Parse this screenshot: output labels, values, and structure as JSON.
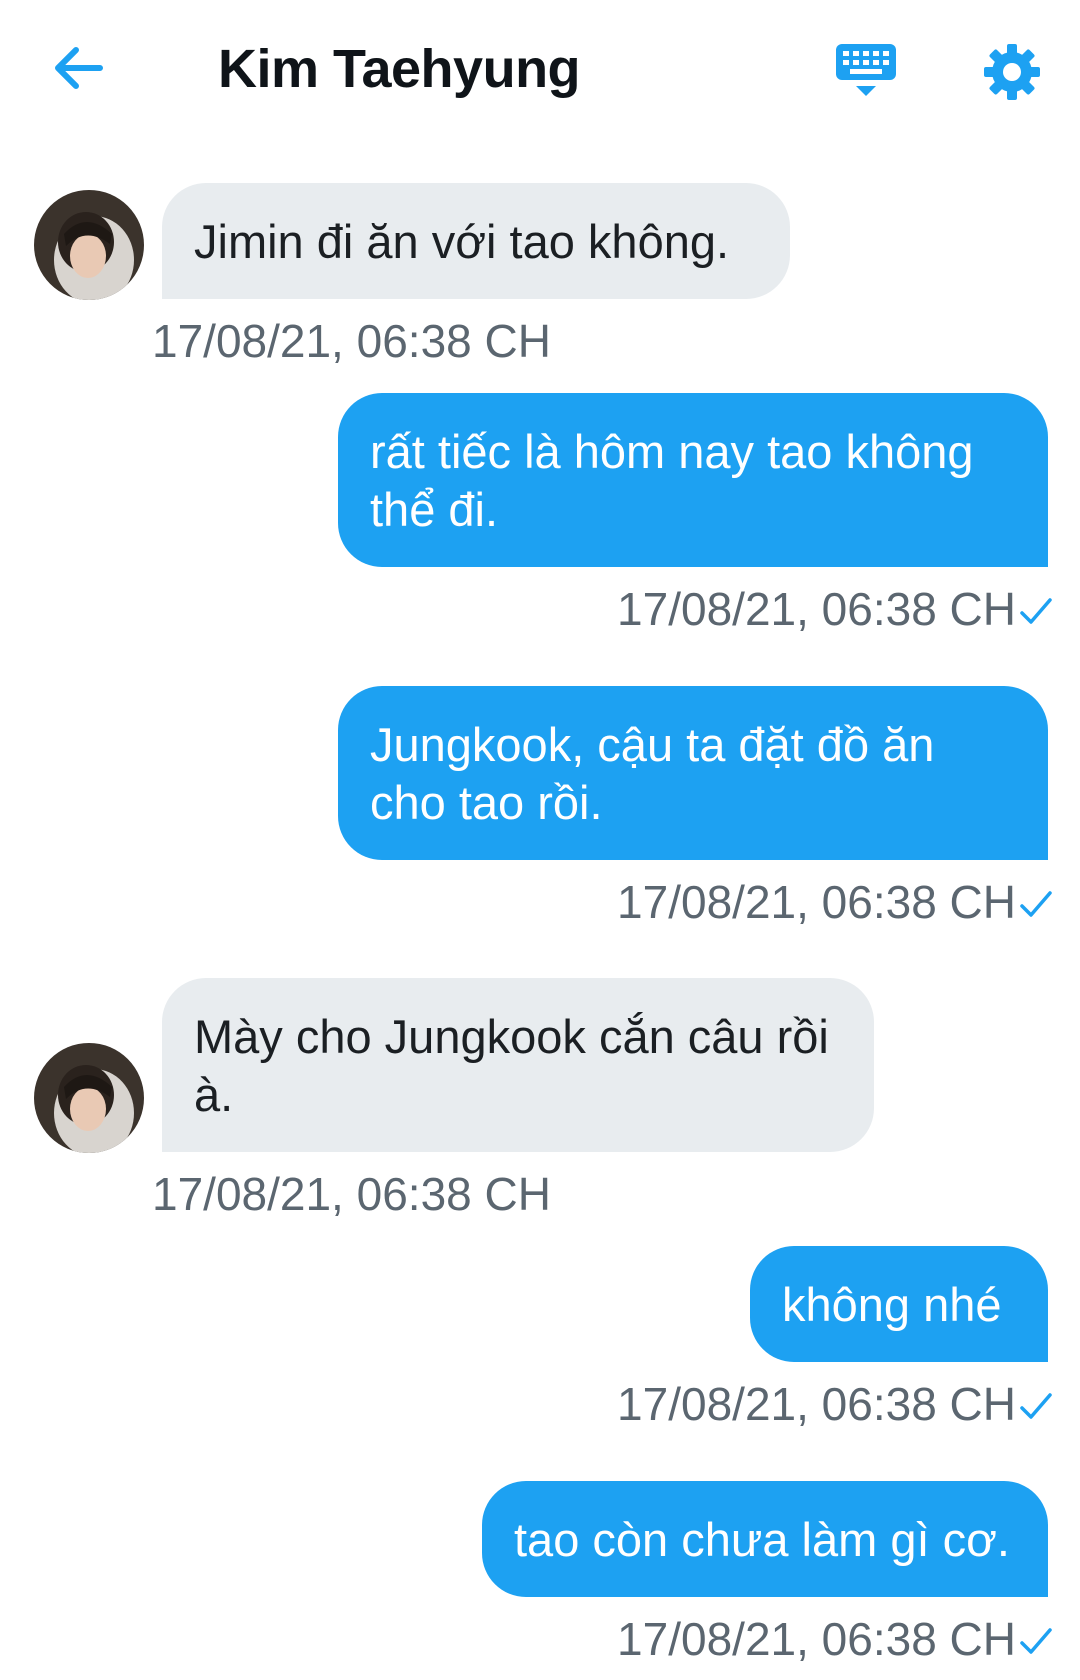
{
  "header": {
    "back_icon": "arrow-left-icon",
    "title": "Kim Taehyung",
    "keyboard_icon": "keyboard-icon",
    "settings_icon": "gear-icon"
  },
  "colors": {
    "accent": "#1da1f2",
    "incoming_bubble": "#e8ecef",
    "timestamp": "#5b6670"
  },
  "messages": [
    {
      "direction": "in",
      "text": "Jimin đi ăn với tao không.",
      "time": "17/08/21, 06:38 CH"
    },
    {
      "direction": "out",
      "text": "rất tiếc là hôm nay tao không thể đi.",
      "time": "17/08/21, 06:38 CH",
      "status_icon": "check-icon"
    },
    {
      "direction": "out",
      "text": "Jungkook, cậu ta đặt đồ ăn cho tao rồi.",
      "time": "17/08/21, 06:38 CH",
      "status_icon": "check-icon"
    },
    {
      "direction": "in",
      "text": "Mày cho Jungkook cắn câu rồi à.",
      "time": "17/08/21, 06:38 CH"
    },
    {
      "direction": "out",
      "text": "không nhé",
      "time": "17/08/21, 06:38 CH",
      "status_icon": "check-icon"
    },
    {
      "direction": "out",
      "text": "tao còn chưa làm gì cơ.",
      "time": "17/08/21, 06:38 CH",
      "status_icon": "check-icon"
    }
  ]
}
